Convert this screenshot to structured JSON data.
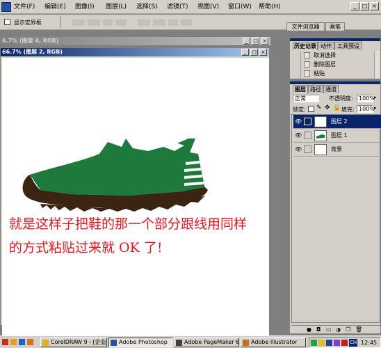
{
  "menubar": {
    "items": [
      "文件(F)",
      "编辑(E)",
      "图像(I)",
      "图层(L)",
      "选择(S)",
      "滤镜(T)",
      "视图(V)",
      "窗口(W)",
      "帮助(H)"
    ],
    "minimize": "_",
    "restore": "□",
    "close": "×"
  },
  "options_bar": {
    "show_bounding_box": "显示定界框",
    "file_browser_tab": "文件浏览器",
    "brushes_tab": "画笔"
  },
  "doc_window_back": {
    "title": "6.7% (图层 4, RGB)"
  },
  "doc_window_front": {
    "title": "66.7% (图层 2, RGB)",
    "caption_line1": "就是这样子把鞋的那一个部分跟线用同样",
    "caption_line2": "的方式粘贴过来就 OK 了!"
  },
  "history_panel": {
    "tabs": [
      "历史记录",
      "动作",
      "工具预设"
    ],
    "items": [
      "取消选择",
      "删除图层",
      "粘贴"
    ]
  },
  "layers_panel": {
    "tabs": [
      "图层",
      "路径",
      "通道"
    ],
    "blend_mode": "正常",
    "opacity_label": "不透明度:",
    "opacity_value": "100%",
    "lock_label": "锁定:",
    "fill_label": "填充:",
    "fill_value": "100%",
    "layers": [
      {
        "name": "图层 2",
        "active": true
      },
      {
        "name": "图层 1",
        "active": false
      },
      {
        "name": "背景",
        "active": false
      }
    ]
  },
  "taskbar": {
    "tasks": [
      "CorelDRAW 9 - [企业...",
      "Adobe Photoshop",
      "Adobe PageMaker 6.5...",
      "Adobe Illustrator"
    ],
    "clock": "12:45",
    "ime": "CH"
  },
  "colors": {
    "shoe_upper": "#1e7a3c",
    "shoe_sole": "#3b2412",
    "caption": "#e8141c",
    "title_active": "#0a246a"
  }
}
